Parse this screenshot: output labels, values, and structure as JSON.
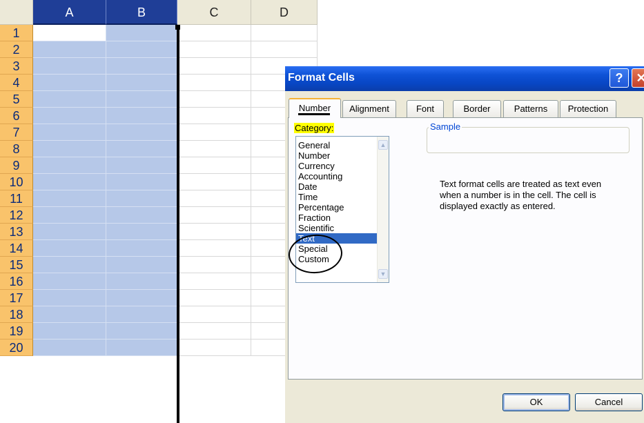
{
  "spreadsheet": {
    "columns": [
      "A",
      "B",
      "C",
      "D"
    ],
    "rows": [
      "1",
      "2",
      "3",
      "4",
      "5",
      "6",
      "7",
      "8",
      "9",
      "10",
      "11",
      "12",
      "13",
      "14",
      "15",
      "16",
      "17",
      "18",
      "19",
      "20"
    ],
    "selected_columns": [
      "A",
      "B"
    ],
    "active_cell": "A1"
  },
  "dialog": {
    "title": "Format Cells",
    "help_glyph": "?",
    "close_glyph": "✕",
    "tabs": [
      {
        "label": "Number"
      },
      {
        "label": "Alignment"
      },
      {
        "label": "Font"
      },
      {
        "label": "Border"
      },
      {
        "label": "Patterns"
      },
      {
        "label": "Protection"
      }
    ],
    "active_tab": "Number",
    "category_label": "Category:",
    "categories": [
      "General",
      "Number",
      "Currency",
      "Accounting",
      "Date",
      "Time",
      "Percentage",
      "Fraction",
      "Scientific",
      "Text",
      "Special",
      "Custom"
    ],
    "selected_category": "Text",
    "sample_label": "Sample",
    "description": "Text format cells are treated as text even when a number is in the cell.  The cell is displayed exactly as entered.",
    "ok_label": "OK",
    "cancel_label": "Cancel"
  },
  "colors": {
    "selection": "#b6c8e8",
    "header_selected": "#1f3e97",
    "row_header": "#f9c36b",
    "titlebar": "#0846c4",
    "list_selected": "#316ac5"
  }
}
